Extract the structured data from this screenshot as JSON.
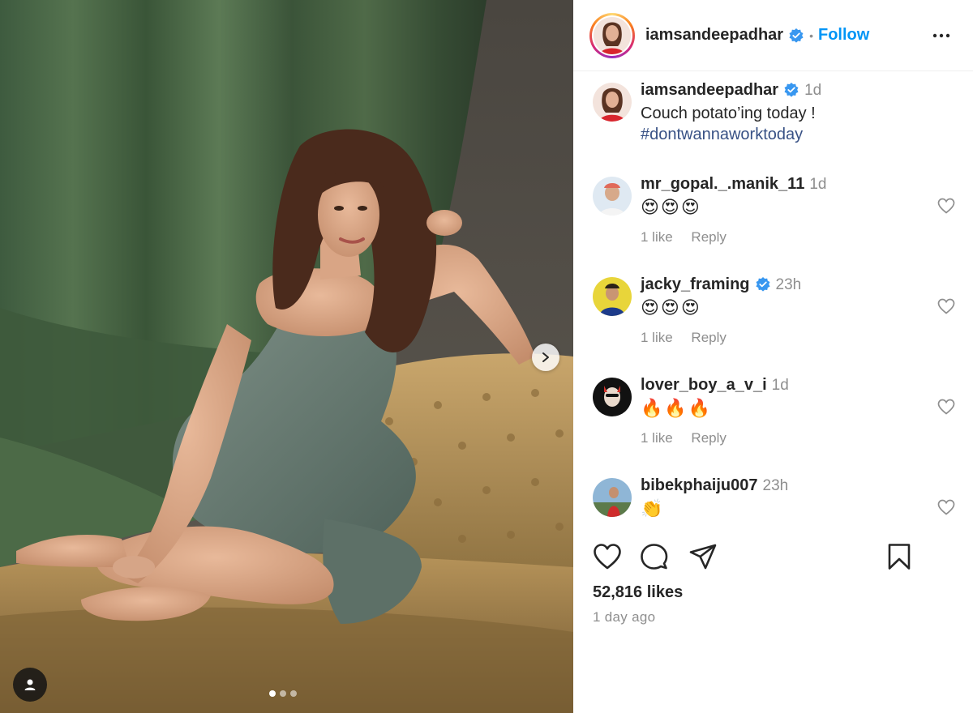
{
  "post": {
    "username": "iamsandeepadhar",
    "follow_label": "Follow",
    "separator": "•",
    "caption_text": "Couch potato’ing today !",
    "caption_hashtag": "#dontwannaworktoday",
    "caption_time": "1d",
    "likes": "52,816 likes",
    "posted": "1 day ago",
    "carousel_count": 3,
    "carousel_active": 1
  },
  "comments": [
    {
      "user": "mr_gopal._.manik_11",
      "time": "1d",
      "text": "😍😍😍",
      "likes": "1 like",
      "reply": "Reply",
      "verified": false
    },
    {
      "user": "jacky_framing",
      "time": "23h",
      "text": "😍😍😍",
      "likes": "1 like",
      "reply": "Reply",
      "verified": true
    },
    {
      "user": "lover_boy_a_v_i",
      "time": "1d",
      "text": "🔥🔥🔥",
      "likes": "1 like",
      "reply": "Reply",
      "verified": false
    },
    {
      "user": "bibekphaiju007",
      "time": "23h",
      "text": "👏",
      "likes": "",
      "reply": "",
      "verified": false
    }
  ],
  "icons": {
    "like": "heart-icon",
    "comment": "comment-icon",
    "share": "share-icon",
    "save": "bookmark-icon",
    "more": "more-icon",
    "verified": "verified-badge-icon",
    "next": "chevron-right-icon",
    "tag": "user-tag-icon"
  },
  "colors": {
    "follow": "#0095f6",
    "verified": "#3897f0",
    "hashtag": "#385185",
    "muted": "#8e8e8e"
  }
}
